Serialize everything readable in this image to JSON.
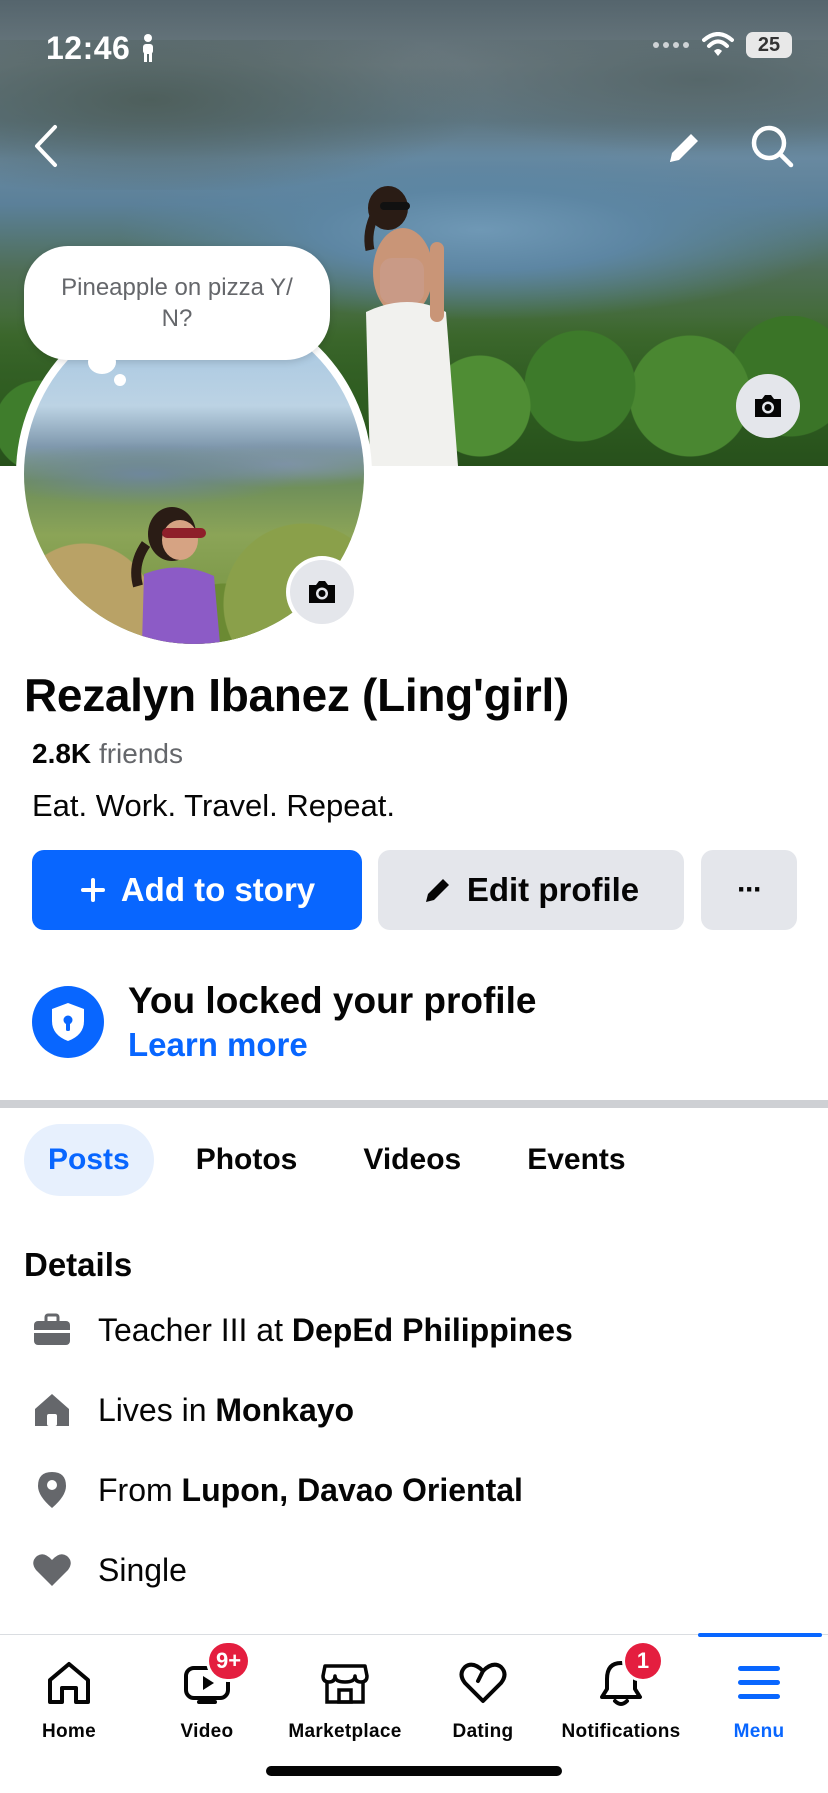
{
  "status_bar": {
    "time": "12:46",
    "battery": "25"
  },
  "profile": {
    "note": "Pineapple on pizza Y/ N?",
    "name": "Rezalyn Ibanez (Ling'girl)",
    "friends_count": "2.8K",
    "friends_label": "friends",
    "bio": "Eat. Work. Travel. Repeat."
  },
  "actions": {
    "add_story": "Add to story",
    "edit_profile": "Edit profile",
    "more": "···"
  },
  "lock_notice": {
    "title": "You locked your profile",
    "link": "Learn more"
  },
  "tabs": [
    {
      "label": "Posts",
      "active": true
    },
    {
      "label": "Photos"
    },
    {
      "label": "Videos"
    },
    {
      "label": "Events"
    }
  ],
  "details": {
    "title": "Details",
    "items": [
      {
        "icon": "briefcase-icon",
        "prefix": "Teacher III at ",
        "bold": "DepEd Philippines"
      },
      {
        "icon": "house-icon",
        "prefix": "Lives in ",
        "bold": "Monkayo"
      },
      {
        "icon": "location-pin-icon",
        "prefix": "From ",
        "bold": "Lupon, Davao Oriental"
      },
      {
        "icon": "heart-icon",
        "prefix": "Single",
        "bold": ""
      }
    ]
  },
  "bottom_nav": [
    {
      "label": "Home",
      "icon": "home-icon"
    },
    {
      "label": "Video",
      "icon": "video-icon",
      "badge": "9+"
    },
    {
      "label": "Marketplace",
      "icon": "marketplace-icon"
    },
    {
      "label": "Dating",
      "icon": "dating-heart-icon"
    },
    {
      "label": "Notifications",
      "icon": "bell-icon",
      "badge": "1"
    },
    {
      "label": "Menu",
      "icon": "menu-icon",
      "active": true
    }
  ],
  "colors": {
    "accent": "#0866ff",
    "badge": "#e41e3f",
    "secondary_button": "#e4e6eb"
  }
}
